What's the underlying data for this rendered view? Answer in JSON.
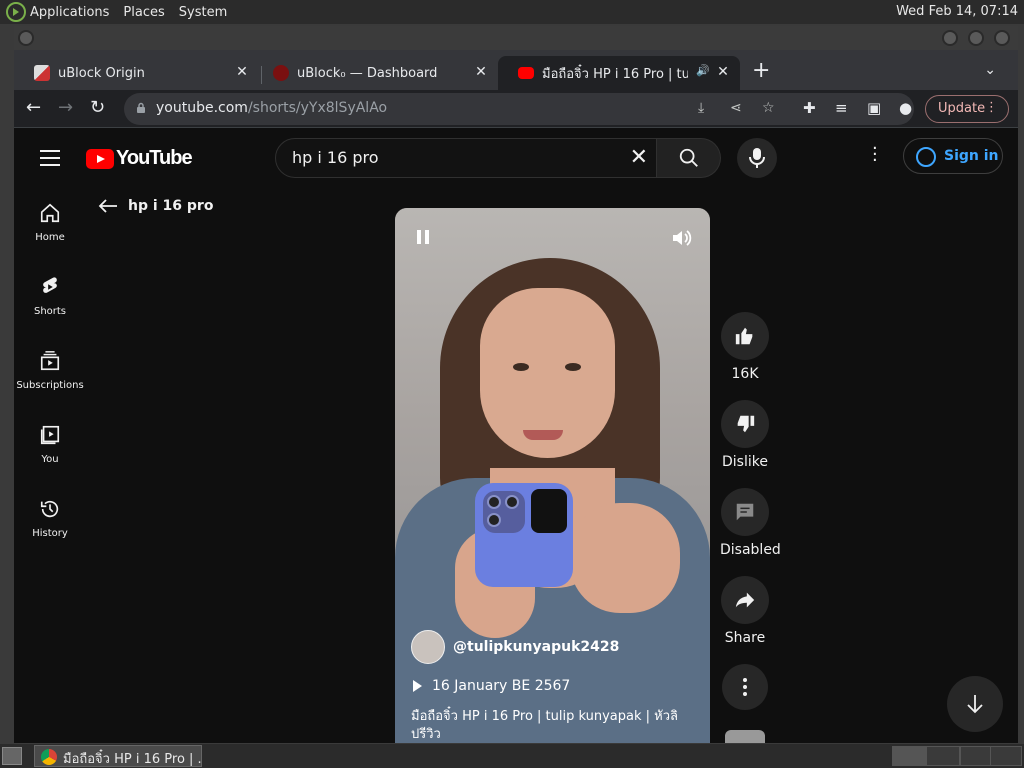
{
  "top_panel": {
    "menus": [
      "Applications",
      "Places",
      "System"
    ],
    "clock": "Wed Feb 14, 07:14"
  },
  "tabs": [
    {
      "title": "uBlock Origin",
      "active": false
    },
    {
      "title": "uBlock₀ — Dashboard",
      "active": false
    },
    {
      "title": "มือถือจิ๋ว HP i 16 Pro | tulip kunyapak | หัวลิปรีวิว",
      "active": true
    }
  ],
  "toolbar": {
    "url_host": "youtube.com",
    "url_path": "/shorts/yYx8lSyAlAo",
    "update_label": "Update"
  },
  "youtube": {
    "logo_text": "YouTube",
    "search_value": "hp i 16 pro",
    "signin_label": "Sign in",
    "guide": [
      {
        "label": "Home",
        "icon": "home-icon"
      },
      {
        "label": "Shorts",
        "icon": "shorts-icon"
      },
      {
        "label": "Subscriptions",
        "icon": "subscriptions-icon"
      },
      {
        "label": "You",
        "icon": "you-icon"
      },
      {
        "label": "History",
        "icon": "history-icon"
      }
    ],
    "back_label": "hp i 16 pro",
    "short": {
      "channel": "@tulipkunyapuk2428",
      "date": "16 January BE 2567",
      "title": "มือถือจิ๋ว HP i 16 Pro | tulip kunyapak | หัวลิปรีวิว"
    },
    "actions": {
      "like": "16K",
      "dislike": "Dislike",
      "comments": "Disabled",
      "share": "Share"
    }
  },
  "taskbar": {
    "task_title": "มือถือจิ๋ว HP i 16 Pro | ..."
  }
}
